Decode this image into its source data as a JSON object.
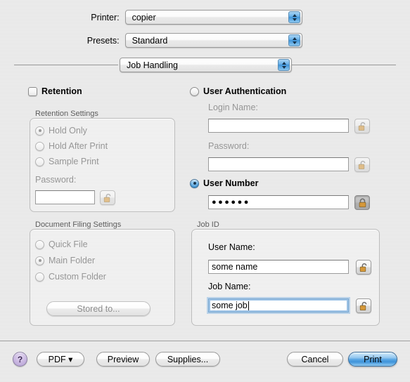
{
  "dialog": {
    "printer": {
      "label": "Printer:",
      "value": "copier"
    },
    "presets": {
      "label": "Presets:",
      "value": "Standard"
    },
    "pane": {
      "value": "Job Handling"
    }
  },
  "retention": {
    "checkbox_label": "Retention",
    "checked": false,
    "group_title": "Retention Settings",
    "options": [
      {
        "label": "Hold Only",
        "selected": true
      },
      {
        "label": "Hold After Print",
        "selected": false
      },
      {
        "label": "Sample Print",
        "selected": false
      }
    ],
    "password_label": "Password:",
    "password_value": "",
    "lock_icon": "unlocked-icon"
  },
  "document_filing": {
    "group_title": "Document Filing Settings",
    "options": [
      {
        "label": "Quick File",
        "selected": false
      },
      {
        "label": "Main Folder",
        "selected": true
      },
      {
        "label": "Custom Folder",
        "selected": false
      }
    ],
    "stored_to_label": "Stored to..."
  },
  "authentication": {
    "user_auth_label": "User Authentication",
    "user_auth_selected": false,
    "login_name_label": "Login Name:",
    "login_name_value": "",
    "login_lock_icon": "unlocked-icon",
    "password_label": "Password:",
    "password_value": "",
    "password_lock_icon": "unlocked-icon",
    "user_number_label": "User Number",
    "user_number_selected": true,
    "user_number_value": "●●●●●●",
    "user_number_lock_icon": "locked-icon"
  },
  "job_id": {
    "group_title": "Job ID",
    "user_name_label": "User Name:",
    "user_name_value": "some name",
    "user_name_lock_icon": "unlocked-icon",
    "job_name_label": "Job Name:",
    "job_name_value": "some job",
    "job_name_focused": true,
    "job_name_lock_icon": "unlocked-icon"
  },
  "footer": {
    "help_label": "?",
    "pdf_label": "PDF ▾",
    "preview_label": "Preview",
    "supplies_label": "Supplies...",
    "cancel_label": "Cancel",
    "print_label": "Print"
  },
  "colors": {
    "accent_blue": "#3f93d8",
    "lock_orange": "#e89a2c",
    "help_purple": "#b4a0d2",
    "window_bg": "#ededed"
  }
}
